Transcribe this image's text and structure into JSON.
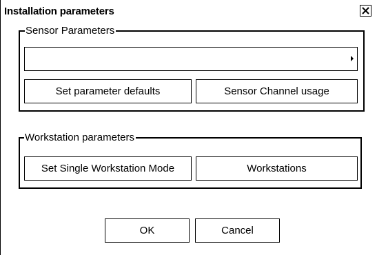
{
  "dialog": {
    "title": "Installation parameters",
    "close_icon": "close-icon"
  },
  "sensor_group": {
    "legend": "Sensor Parameters",
    "combo_value": "",
    "combo_arrow_icon": "triangle-right-icon",
    "set_defaults_label": "Set parameter defaults",
    "channel_usage_label": "Sensor Channel usage"
  },
  "workstation_group": {
    "legend": "Workstation parameters",
    "single_mode_label": "Set Single Workstation Mode",
    "workstations_label": "Workstations"
  },
  "footer": {
    "ok_label": "OK",
    "cancel_label": "Cancel"
  }
}
